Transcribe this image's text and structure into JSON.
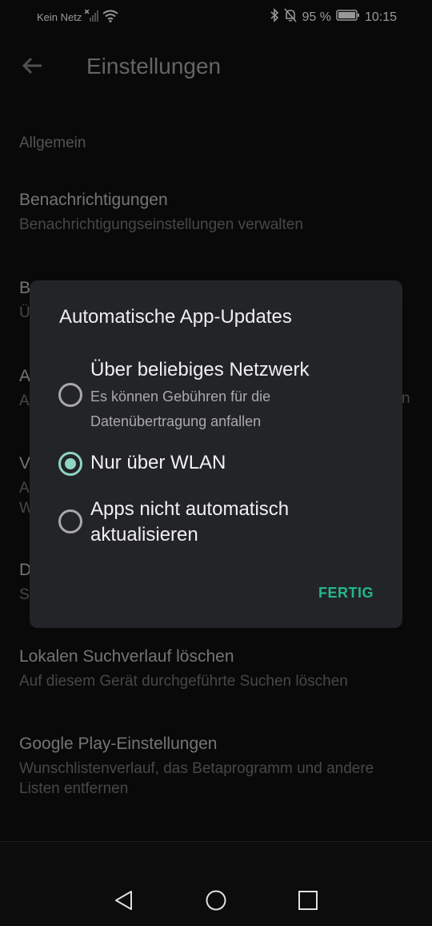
{
  "status_bar": {
    "carrier": "Kein Netz",
    "battery_percent": "95 %",
    "time": "10:15",
    "icons": [
      "no-signal-icon",
      "wifi-icon",
      "bluetooth-icon",
      "mute-icon",
      "battery-icon"
    ]
  },
  "app_bar": {
    "title": "Einstellungen"
  },
  "settings": {
    "section_label": "Allgemein",
    "items": [
      {
        "title": "Benachrichtigungen",
        "subtitle": "Benachrichtigungseinstellungen verwalten"
      },
      {
        "title": "B",
        "subtitle": "Ü"
      },
      {
        "title": "A",
        "subtitle": "A"
      },
      {
        "title": "V",
        "subtitle": "A"
      },
      {
        "title": "D",
        "subtitle": "S"
      },
      {
        "title": "Lokalen Suchverlauf löschen",
        "subtitle": "Auf diesem Gerät durchgeführte Suchen löschen"
      },
      {
        "title": "Google Play-Einstellungen",
        "subtitle": "Wunschlistenverlauf, das Betaprogramm und andere Listen entfernen"
      }
    ],
    "partial_extras": {
      "item_3_trailing": "n",
      "item_4_line2": "W"
    }
  },
  "dialog": {
    "title": "Automatische App-Updates",
    "options": [
      {
        "label": "Über beliebiges Netzwerk",
        "description": "Es können Gebühren für die Datenübertragung anfallen",
        "selected": false
      },
      {
        "label": "Nur über WLAN",
        "description": "",
        "selected": true
      },
      {
        "label": "Apps nicht automatisch aktualisieren",
        "description": "",
        "selected": false
      }
    ],
    "confirm_label": "FERTIG"
  },
  "colors": {
    "accent": "#8fd5c1",
    "button_text": "#25b58a",
    "dialog_bg": "#232428"
  },
  "nav_bar": {
    "icons": [
      "back-triangle-icon",
      "home-circle-icon",
      "recents-square-icon"
    ]
  }
}
